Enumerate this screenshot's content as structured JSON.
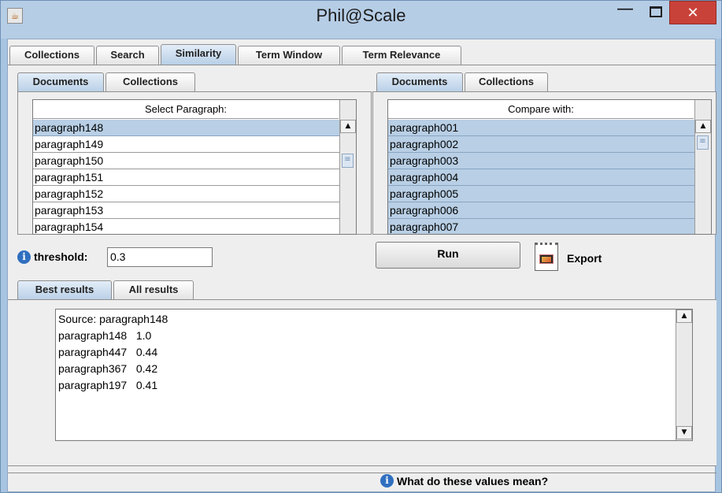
{
  "window": {
    "title": "Phil@Scale",
    "minimize": "—",
    "close": "✕"
  },
  "main_tabs": [
    {
      "label": "Collections"
    },
    {
      "label": "Search"
    },
    {
      "label": "Similarity"
    },
    {
      "label": "Term Window"
    },
    {
      "label": "Term Relevance"
    }
  ],
  "left": {
    "tabs": [
      {
        "label": "Documents"
      },
      {
        "label": "Collections"
      }
    ],
    "header": "Select Paragraph:",
    "items": [
      "paragraph148",
      "paragraph149",
      "paragraph150",
      "paragraph151",
      "paragraph152",
      "paragraph153",
      "paragraph154"
    ]
  },
  "right": {
    "tabs": [
      {
        "label": "Documents"
      },
      {
        "label": "Collections"
      }
    ],
    "header": "Compare with:",
    "items": [
      "paragraph001",
      "paragraph002",
      "paragraph003",
      "paragraph004",
      "paragraph005",
      "paragraph006",
      "paragraph007"
    ]
  },
  "threshold": {
    "label": "threshold:",
    "value": "0.3"
  },
  "run_label": "Run",
  "export_label": "Export",
  "results": {
    "tabs": [
      {
        "label": "Best results"
      },
      {
        "label": "All results"
      }
    ],
    "lines": [
      "Source: paragraph148",
      "paragraph148   1.0",
      "paragraph447   0.44",
      "paragraph367   0.42",
      "paragraph197   0.41"
    ]
  },
  "help_label": "What do these values mean?",
  "colors": {
    "selection": "#b8cfe5",
    "title_bar": "#b6cde6",
    "close_button": "#c9423a",
    "info_icon": "#2f6fc0"
  }
}
